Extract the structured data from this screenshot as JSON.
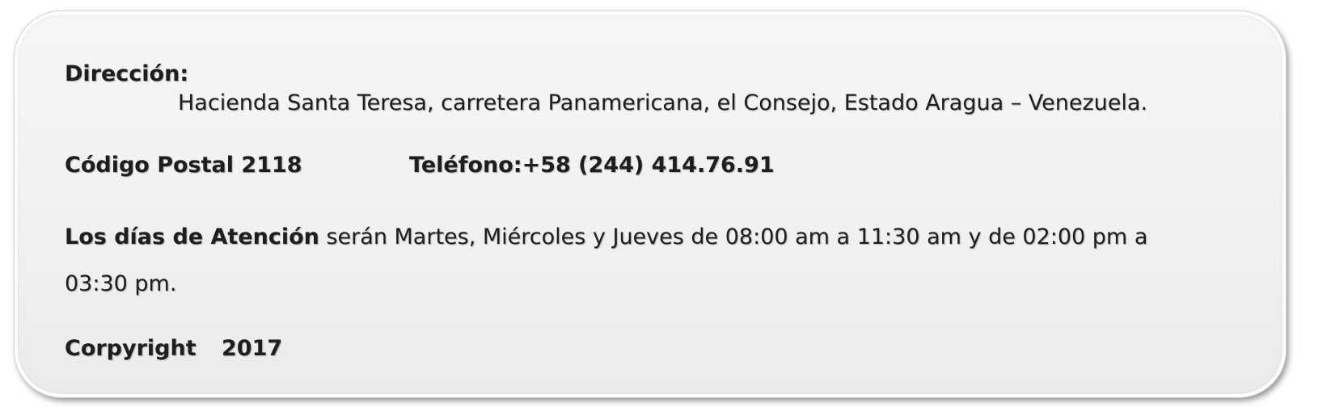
{
  "address": {
    "label": "Dirección:",
    "value": "Hacienda Santa Teresa, carretera Panamericana, el Consejo, Estado Aragua – Venezuela."
  },
  "contact": {
    "postal_code": "Código Postal 2118",
    "phone": "Teléfono:+58 (244)  414.76.91"
  },
  "hours": {
    "lead": "Los días de Atención",
    "text_line1": " serán Martes, Miércoles y Jueves de 08:00 am a 11:30 am y de 02:00 pm a",
    "text_line2": "03:30 pm."
  },
  "copyright": {
    "label": "Corpyright",
    "year": "2017"
  }
}
